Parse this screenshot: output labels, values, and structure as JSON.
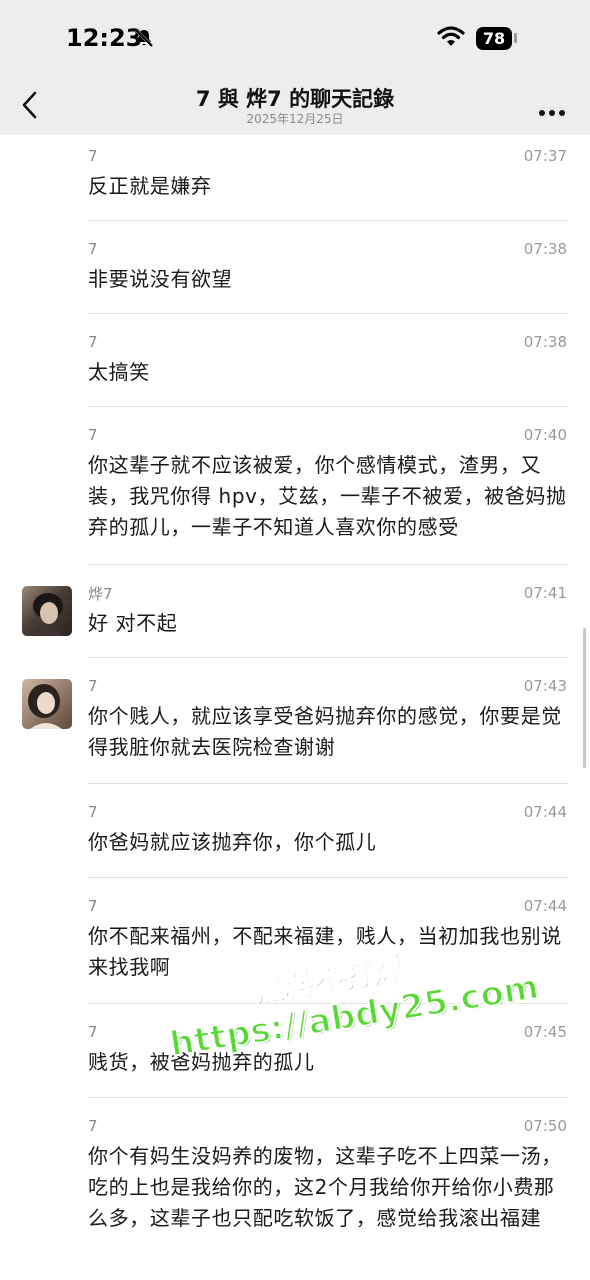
{
  "status_bar": {
    "time": "12:23",
    "battery": "78"
  },
  "header": {
    "title": "7 與 烨7 的聊天記錄",
    "date": "2025年12月25日"
  },
  "messages": [
    {
      "sender": "7",
      "time": "07:37",
      "text": "反正就是嫌弃",
      "avatar": false
    },
    {
      "sender": "7",
      "time": "07:38",
      "text": "非要说没有欲望",
      "avatar": false
    },
    {
      "sender": "7",
      "time": "07:38",
      "text": "太搞笑",
      "avatar": false
    },
    {
      "sender": "7",
      "time": "07:40",
      "text": "你这辈子就不应该被爱，你个感情模式，渣男，又装，我咒你得 hpv，艾兹，一辈子不被爱，被爸妈抛弃的孤儿，一辈子不知道人喜欢你的感受",
      "avatar": false
    },
    {
      "sender": "烨7",
      "time": "07:41",
      "text": "好 对不起",
      "avatar": true
    },
    {
      "sender": "7",
      "time": "07:43",
      "text": "你个贱人，就应该享受爸妈抛弃你的感觉，你要是觉得我脏你就去医院检查谢谢",
      "avatar": true
    },
    {
      "sender": "7",
      "time": "07:44",
      "text": "你爸妈就应该抛弃你，你个孤儿",
      "avatar": false
    },
    {
      "sender": "7",
      "time": "07:44",
      "text": "你不配来福州，不配来福建，贱人，当初加我也别说来找我啊",
      "avatar": false
    },
    {
      "sender": "7",
      "time": "07:45",
      "text": "贱货，被爸妈抛弃的孤儿",
      "avatar": false
    },
    {
      "sender": "7",
      "time": "07:50",
      "text": "你个有妈生没妈养的废物，这辈子吃不上四菜一汤，吃的上也是我给你的，这2个月我给你开给你小费那么多，这辈子也只配吃软饭了，感觉给我滚出福建",
      "avatar": false
    }
  ],
  "watermark": {
    "line1": "黑料不打烊",
    "line2": "https://abdy25.com"
  }
}
